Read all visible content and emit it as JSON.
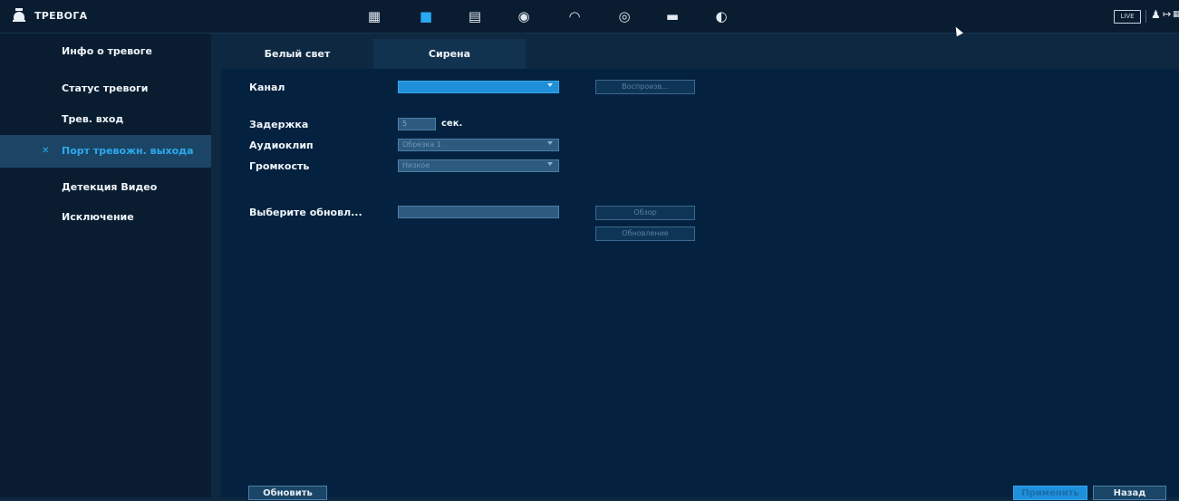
{
  "header": {
    "title": "ТРЕВОГА",
    "icons": [
      "camera-icon",
      "alarm-siren-icon",
      "storage-icon",
      "ai-face-icon",
      "performance-gauge-icon",
      "record-icon",
      "display-icon",
      "audio-icon"
    ],
    "active_icon": "alarm-siren-icon",
    "live_label": "LIVE",
    "accent_color": "#29a9f0"
  },
  "sidebar": {
    "items": [
      {
        "label": "Инфо о тревоге"
      },
      {
        "label": "Статус тревоги"
      },
      {
        "label": "Трев. вход"
      },
      {
        "label": "Порт тревожн. выхода",
        "active": true
      },
      {
        "label": "Детекция Видео"
      },
      {
        "label": "Исключение"
      }
    ]
  },
  "tabs": [
    {
      "label": "Белый свет"
    },
    {
      "label": "Сирена",
      "active": true
    }
  ],
  "form": {
    "channel_label": "Канал",
    "channel_value": "",
    "play_button": "Воспроизв...",
    "delay_label": "Задержка",
    "delay_value": "5",
    "delay_unit": "сек.",
    "audioclip_label": "Аудиоклип",
    "audioclip_value": "Обрезка 1",
    "volume_label": "Громкость",
    "volume_value": "Низкое",
    "select_update_label": "Выберите обновл...",
    "update_path_value": "",
    "browse_button": "Обзор",
    "update_button": "Обновление"
  },
  "footer": {
    "refresh_button": "Обновить",
    "apply_button": "Применить",
    "back_button": "Назад"
  }
}
